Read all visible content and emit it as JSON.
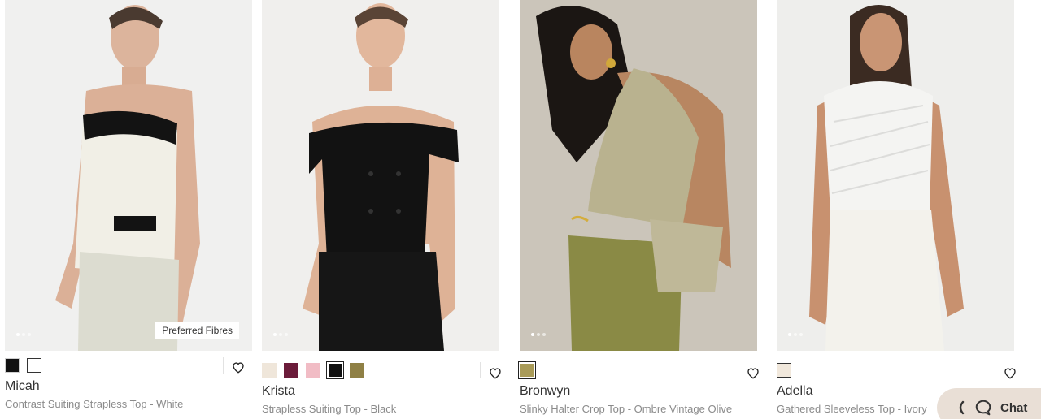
{
  "products": [
    {
      "name": "Micah",
      "description": "Contrast Suiting Strapless Top - White",
      "badge": "Preferred Fibres",
      "swatches": [
        "#111111",
        "#ffffff"
      ],
      "image_icon": "model-photo-strapless-contrast-top"
    },
    {
      "name": "Krista",
      "description": "Strapless Suiting Top - Black",
      "swatches": [
        "#efe6da",
        "#6b1b3a",
        "#f1bcc5",
        "#111111",
        "#8f8045"
      ],
      "selected_swatch": 3,
      "image_icon": "model-photo-black-suiting-top"
    },
    {
      "name": "Bronwyn",
      "description": "Slinky Halter Crop Top - Ombre Vintage Olive",
      "swatches": [
        "#a99b58"
      ],
      "selected_swatch": 0,
      "image_icon": "model-photo-halter-crop-top"
    },
    {
      "name": "Adella",
      "description": "Gathered Sleeveless Top - Ivory",
      "swatches": [
        "#f1e8dc"
      ],
      "image_icon": "model-photo-gathered-sleeveless-top"
    }
  ],
  "chat": {
    "label": "Chat",
    "icon": "chat-bubble-icon"
  },
  "wishlist_icon": "heart-icon"
}
